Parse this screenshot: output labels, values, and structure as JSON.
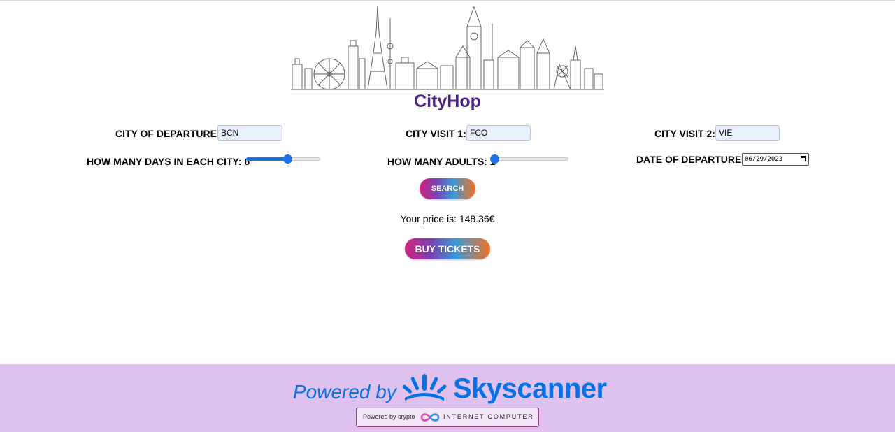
{
  "app": {
    "name": "CityHop"
  },
  "form": {
    "departure": {
      "label": "CITY OF DEPARTURE:",
      "value": "BCN"
    },
    "visit1": {
      "label": "CITY VISIT 1:",
      "value": "FCO"
    },
    "visit2": {
      "label": "CITY VISIT 2:",
      "value": "VIE"
    },
    "days": {
      "label": "HOW MANY DAYS IN EACH CITY: 6",
      "value": 6,
      "min": 1,
      "max": 10
    },
    "adults": {
      "label": "HOW MANY ADULTS: 1",
      "value": 1,
      "min": 1,
      "max": 10
    },
    "date": {
      "label": "DATE OF DEPARTURE:",
      "value": "06/29/2023"
    }
  },
  "buttons": {
    "search": "SEARCH",
    "buy": "BUY TICKETS"
  },
  "result": {
    "price_text": "Your price is: 148.36€"
  },
  "footer": {
    "powered_by": "Powered by",
    "brand": "Skyscanner",
    "badge_prefix": "Powered by crypto",
    "badge_brand": "INTERNET COMPUTER"
  },
  "colors": {
    "brand_purple": "#4b2284",
    "accent_blue": "#1a73e8",
    "skyscanner_blue": "#0770e3",
    "footer_bg": "#dfc1f0"
  },
  "icons": {
    "skyline": "city-skyline-illustration",
    "sky_logo": "skyscanner-sun-logo",
    "ic_logo": "infinity-icon",
    "calendar": "calendar-icon"
  }
}
